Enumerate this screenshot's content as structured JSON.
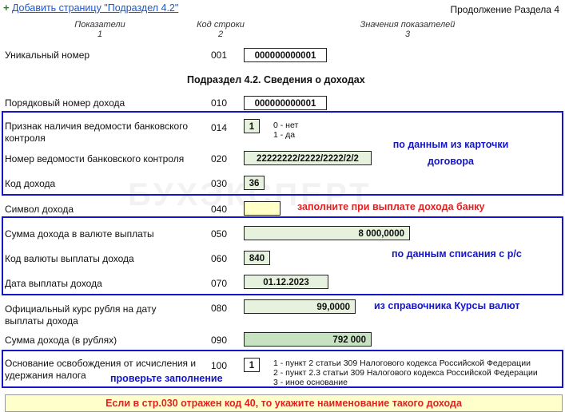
{
  "header": {
    "add_link": "Добавить страницу \"Подраздел 4.2\"",
    "continuation": "Продолжение Раздела 4"
  },
  "columns": [
    {
      "title": "Показатели",
      "num": "1"
    },
    {
      "title": "Код строки",
      "num": "2"
    },
    {
      "title": "Значения показателей",
      "num": "3"
    }
  ],
  "unique": {
    "label": "Уникальный номер",
    "code": "001",
    "value": "000000000001"
  },
  "subsection_title": "Подраздел 4.2. Сведения о доходах",
  "rows": {
    "r010": {
      "label": "Порядковый номер дохода",
      "code": "010",
      "value": "000000000001"
    },
    "r014": {
      "label": "Признак наличия ведомости банковского контроля",
      "code": "014",
      "value": "1",
      "hint": [
        "0 - нет",
        "1 - да"
      ]
    },
    "r020": {
      "label": "Номер ведомости банковского контроля",
      "code": "020",
      "value": "22222222/2222/2222/2/2"
    },
    "r030": {
      "label": "Код дохода",
      "code": "030",
      "value": "36"
    },
    "r040": {
      "label": "Символ дохода",
      "code": "040",
      "value": ""
    },
    "r050": {
      "label": "Сумма дохода в валюте выплаты",
      "code": "050",
      "value": "8 000,0000"
    },
    "r060": {
      "label": "Код валюты выплаты дохода",
      "code": "060",
      "value": "840"
    },
    "r070": {
      "label": "Дата выплаты дохода",
      "code": "070",
      "value": "01.12.2023"
    },
    "r080": {
      "label": "Официальный курс рубля на дату выплаты дохода",
      "code": "080",
      "value": "99,0000"
    },
    "r090": {
      "label": "Сумма дохода (в рублях)",
      "code": "090",
      "value": "792 000"
    },
    "r100": {
      "label": "Основание освобождения от исчисления и удержания налога",
      "code": "100",
      "value": "1",
      "options": [
        "1 - пункт 2 статьи 309 Налогового кодекса Российской Федерации",
        "2 - пункт 2.3 статьи 309 Налогового кодекса Российской Федерации",
        "3 - иное основание"
      ]
    }
  },
  "notes": {
    "card": "по данным из карточки договора",
    "bank": "заполните при выплате дохода банку",
    "writeoff": "по данным списания с р/с",
    "rates": "из справочника Курсы валют",
    "check": "проверьте заполнение"
  },
  "banner": "Если в стр.030 отражен код 40, то укажите наименование такого дохода",
  "watermark": "БУХЭКСПЕРТ",
  "colors": {
    "frame": "#1515c8",
    "note_blue": "#1515c8",
    "note_red": "#e12121",
    "green_field": "#e6f2de",
    "yellow_field": "#ffffc8"
  }
}
